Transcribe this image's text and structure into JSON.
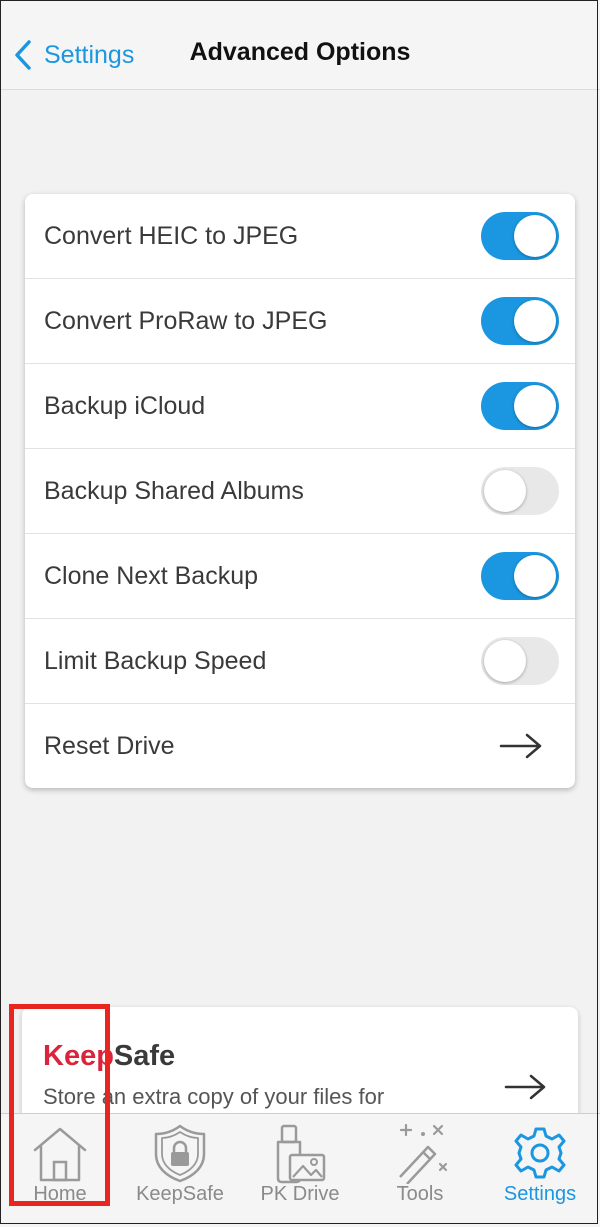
{
  "header": {
    "back_label": "Settings",
    "title": "Advanced Options"
  },
  "settings": {
    "rows": [
      {
        "label": "Convert HEIC to JPEG",
        "control": "toggle",
        "on": true
      },
      {
        "label": "Convert ProRaw to JPEG",
        "control": "toggle",
        "on": true
      },
      {
        "label": "Backup iCloud",
        "control": "toggle",
        "on": true
      },
      {
        "label": "Backup Shared Albums",
        "control": "toggle",
        "on": false
      },
      {
        "label": "Clone Next Backup",
        "control": "toggle",
        "on": true
      },
      {
        "label": "Limit Backup Speed",
        "control": "toggle",
        "on": false
      },
      {
        "label": "Reset Drive",
        "control": "arrow"
      }
    ]
  },
  "promo": {
    "brand_part1": "Keep",
    "brand_part2": "Safe",
    "text": "Store an extra copy of your files for"
  },
  "tabs": [
    {
      "label": "Home",
      "icon": "home-icon",
      "active": false
    },
    {
      "label": "KeepSafe",
      "icon": "shield-lock-icon",
      "active": false
    },
    {
      "label": "PK Drive",
      "icon": "drive-photo-icon",
      "active": false
    },
    {
      "label": "Tools",
      "icon": "magic-wand-icon",
      "active": false
    },
    {
      "label": "Settings",
      "icon": "gear-icon",
      "active": true
    }
  ],
  "colors": {
    "accent": "#1a97e0",
    "brand_red": "#d9243c",
    "highlight": "#e8251f"
  }
}
